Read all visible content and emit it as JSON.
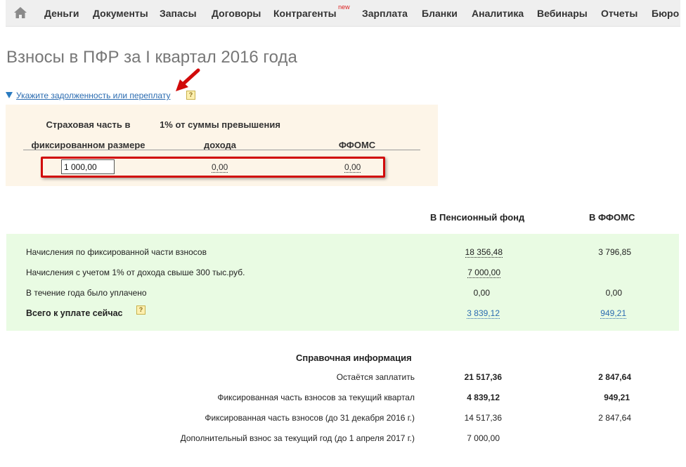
{
  "nav": {
    "items": [
      "Деньги",
      "Документы",
      "Запасы",
      "Договоры",
      "Контрагенты",
      "Зарплата",
      "Бланки",
      "Аналитика",
      "Вебинары",
      "Отчеты",
      "Бюро"
    ],
    "new_badge": "new"
  },
  "page_title": "Взносы в ПФР за I квартал 2016 года",
  "debt": {
    "link_text": "Укажите задолженность или переплату",
    "help": "?",
    "col1_line1": "Страховая часть в",
    "col1_line2": "фиксированном размере",
    "col2_line1": "1% от суммы превышения",
    "col2_line2": "дохода",
    "col3": "ФФОМС",
    "input_value": "1 000,00",
    "col2_value": "0,00",
    "col3_value": "0,00"
  },
  "summary": {
    "col_pf": "В Пенсионный фонд",
    "col_ffoms": "В ФФОМС",
    "rows": [
      {
        "label": "Начисления по фиксированной части взносов",
        "pf": "18 356,48",
        "ffoms": "3 796,85"
      },
      {
        "label": "Начисления с учетом 1% от дохода свыше 300 тыс.руб.",
        "pf": "7 000,00",
        "ffoms": ""
      },
      {
        "label": "В течение года было уплачено",
        "pf": "0,00",
        "ffoms": "0,00"
      },
      {
        "label": "Всего к уплате сейчас",
        "pf": "3 839,12",
        "ffoms": "949,21"
      }
    ],
    "help": "?"
  },
  "reference": {
    "title": "Справочная информация",
    "rows": [
      {
        "label": "Остаётся заплатить",
        "pf": "21 517,36",
        "ffoms": "2 847,64"
      },
      {
        "label": "Фиксированная часть взносов за текущий квартал",
        "pf": "4 839,12",
        "ffoms": "949,21"
      },
      {
        "label": "Фиксированная часть взносов (до 31 декабря 2016 г.)",
        "pf": "14 517,36",
        "ffoms": "2 847,64"
      },
      {
        "label": "Дополнительный взнос за текущий год (до 1 апреля 2017 г.)",
        "pf": "7 000,00",
        "ffoms": ""
      }
    ]
  },
  "colors": {
    "green_panel": "#e9fbe3",
    "debt_panel": "#fdf5e8",
    "link": "#2a6bb0",
    "highlight_red": "#d10a0a"
  }
}
